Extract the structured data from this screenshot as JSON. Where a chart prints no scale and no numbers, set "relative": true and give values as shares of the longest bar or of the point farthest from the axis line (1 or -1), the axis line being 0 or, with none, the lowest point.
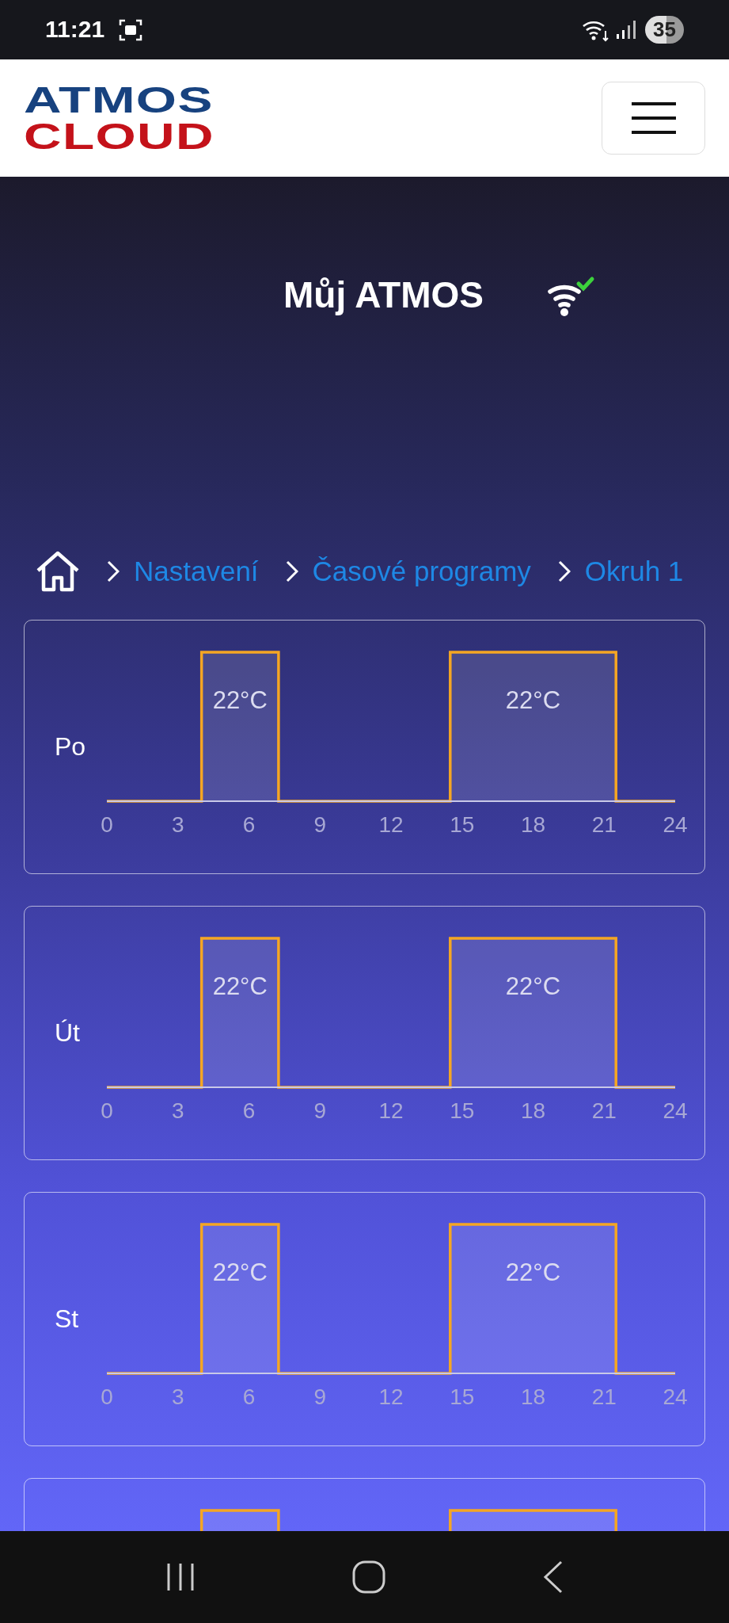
{
  "status_bar": {
    "time": "11:21",
    "battery": "35"
  },
  "header": {
    "logo": [
      "ATMOS",
      "CLOUD"
    ]
  },
  "title": "Můj ATMOS",
  "connection": {
    "online": true
  },
  "breadcrumb": [
    "Nastavení",
    "Časové programy",
    "Okruh 1"
  ],
  "schedules": [
    {
      "kind": "full",
      "day": "Po",
      "chart_data": {
        "type": "line",
        "relative": true,
        "xlim": [
          0,
          24
        ],
        "xticks": [
          0,
          3,
          6,
          9,
          12,
          15,
          18,
          21,
          24
        ],
        "x": [
          0,
          4,
          4,
          7.25,
          7.25,
          14.5,
          14.5,
          21.5,
          21.5,
          24
        ],
        "series": [
          {
            "color": "#f5a623",
            "values": [
              0,
              0,
              1,
              1,
              0,
              0,
              1,
              1,
              0,
              0
            ]
          }
        ],
        "annotations": [
          "22°C",
          "22°C"
        ]
      }
    },
    {
      "kind": "full",
      "day": "Út",
      "chart_data": {
        "type": "line",
        "relative": true,
        "xlim": [
          0,
          24
        ],
        "xticks": [
          0,
          3,
          6,
          9,
          12,
          15,
          18,
          21,
          24
        ],
        "x": [
          0,
          4,
          4,
          7.25,
          7.25,
          14.5,
          14.5,
          21.5,
          21.5,
          24
        ],
        "series": [
          {
            "color": "#f5a623",
            "values": [
              0,
              0,
              1,
              1,
              0,
              0,
              1,
              1,
              0,
              0
            ]
          }
        ],
        "annotations": [
          "22°C",
          "22°C"
        ]
      }
    },
    {
      "kind": "full",
      "day": "St",
      "chart_data": {
        "type": "line",
        "relative": true,
        "xlim": [
          0,
          24
        ],
        "xticks": [
          0,
          3,
          6,
          9,
          12,
          15,
          18,
          21,
          24
        ],
        "x": [
          0,
          4,
          4,
          7.25,
          7.25,
          14.5,
          14.5,
          21.5,
          21.5,
          24
        ],
        "series": [
          {
            "color": "#f5a623",
            "values": [
              0,
              0,
              1,
              1,
              0,
              0,
              1,
              1,
              0,
              0
            ]
          }
        ],
        "annotations": [
          "22°C",
          "22°C"
        ]
      }
    },
    {
      "kind": "partial"
    }
  ]
}
